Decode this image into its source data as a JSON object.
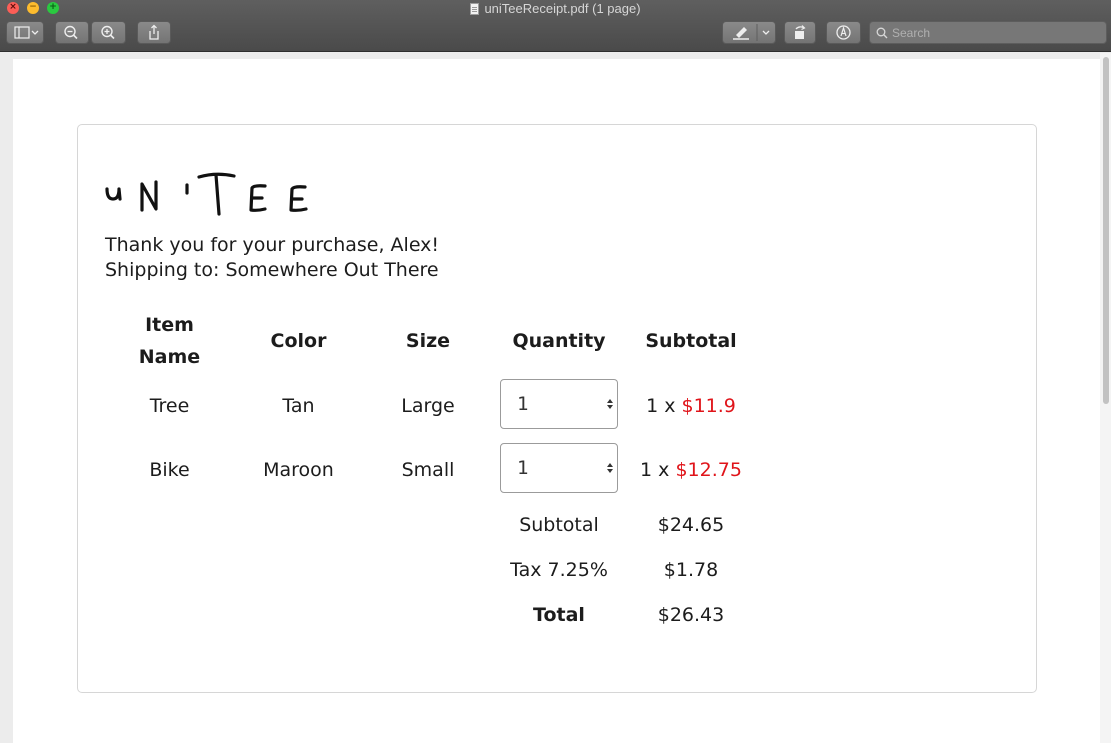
{
  "window": {
    "title": "uniTeeReceipt.pdf (1 page)",
    "search_placeholder": "Search"
  },
  "toolbar": {
    "sidebar_icon": "sidebar-icon",
    "zoom_out_icon": "zoom-out-icon",
    "zoom_in_icon": "zoom-in-icon",
    "share_icon": "share-icon",
    "markup_icon": "highlighter-icon",
    "rotate_icon": "rotate-icon",
    "annotate_icon": "markup-pen-icon"
  },
  "receipt": {
    "logo_text": "uNiTEE",
    "thank_you": "Thank you for your purchase, Alex!",
    "shipping": "Shipping to: Somewhere Out There",
    "headers": {
      "item_name": "Item Name",
      "color": "Color",
      "size": "Size",
      "quantity": "Quantity",
      "subtotal": "Subtotal"
    },
    "items": [
      {
        "name": "Tree",
        "color": "Tan",
        "size": "Large",
        "quantity": "1",
        "qty_prefix": "1 x",
        "price": "$11.9"
      },
      {
        "name": "Bike",
        "color": "Maroon",
        "size": "Small",
        "quantity": "1",
        "qty_prefix": "1 x",
        "price": "$12.75"
      }
    ],
    "summary": {
      "subtotal_label": "Subtotal",
      "subtotal_value": "$24.65",
      "tax_label": "Tax 7.25%",
      "tax_value": "$1.78",
      "total_label": "Total",
      "total_value": "$26.43"
    }
  },
  "colors": {
    "price": "#e0141a",
    "text": "#1c1c1c"
  }
}
